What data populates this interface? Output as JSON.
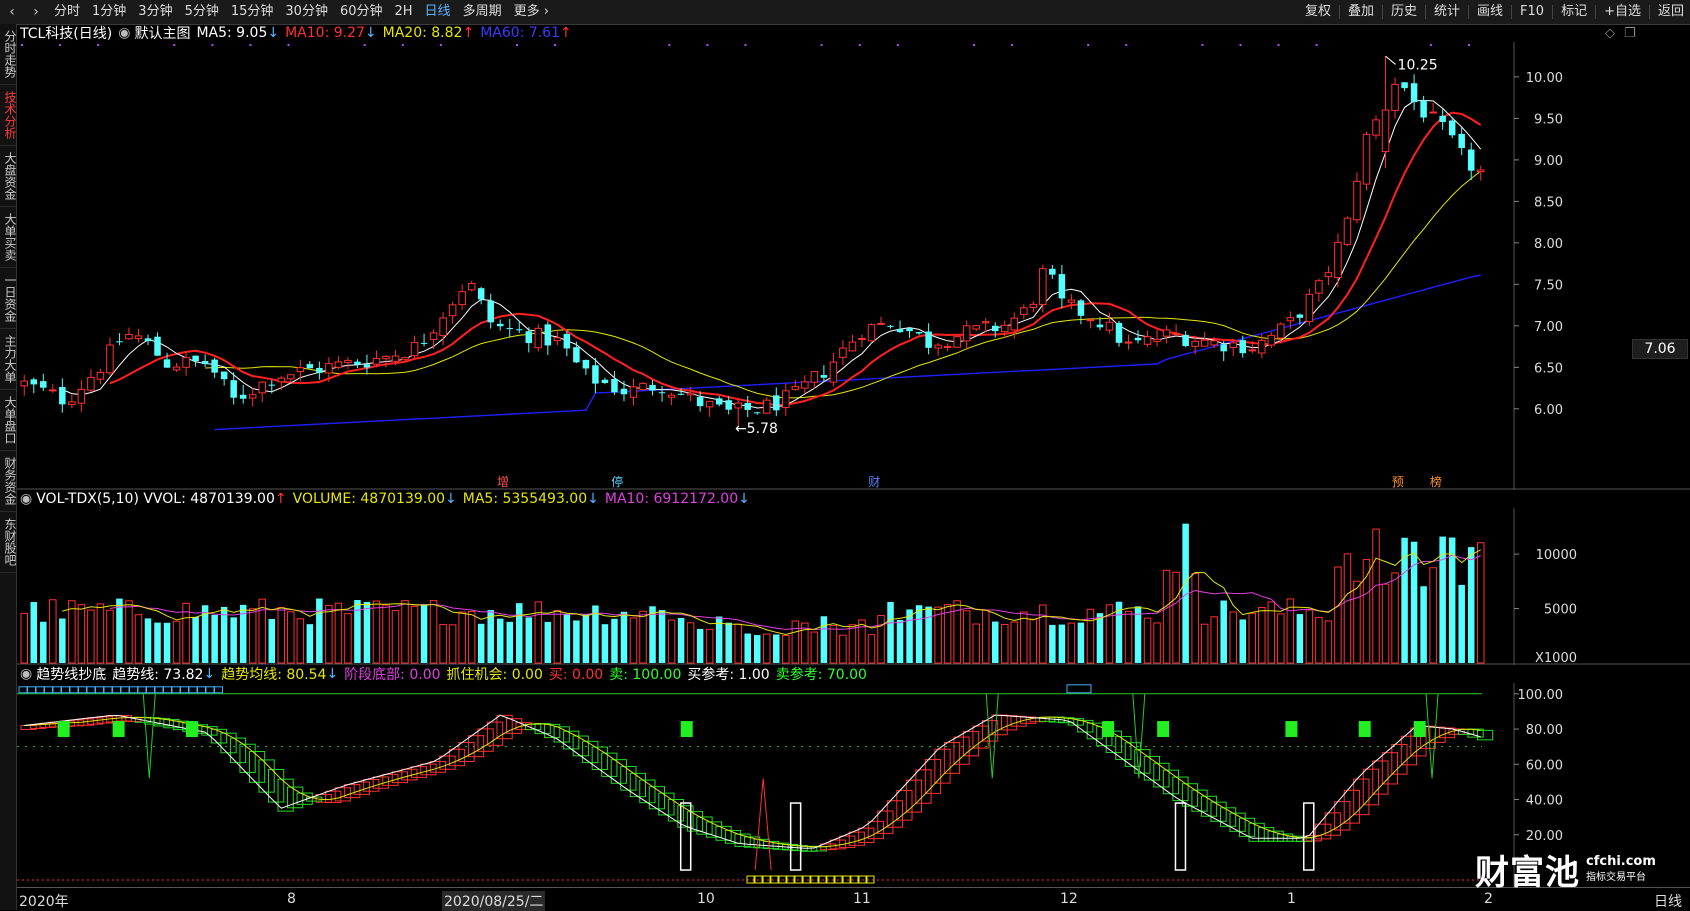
{
  "toolbar": {
    "periods": [
      "分时",
      "1分钟",
      "3分钟",
      "5分钟",
      "15分钟",
      "30分钟",
      "60分钟",
      "2H",
      "日线",
      "多周期",
      "更多"
    ],
    "active_period": "日线",
    "right_items": [
      "复权",
      "叠加",
      "历史",
      "统计",
      "画线",
      "F10",
      "标记",
      "+自选",
      "返回"
    ]
  },
  "sidebar": {
    "items": [
      "分时走势",
      "技术分析",
      "大盘资金",
      "大单买卖",
      "一日资金",
      "主力大单",
      "大单盘口",
      "财务资金",
      "东财股吧"
    ],
    "active": "技术分析"
  },
  "main_chart": {
    "stock_name": "TCL科技(日线)",
    "indicator_name": "默认主图",
    "ma5": {
      "label": "MA5: 9.05",
      "arrow": "↓",
      "color": "#ffffff"
    },
    "ma10": {
      "label": "MA10: 9.27",
      "arrow": "↓",
      "color": "#ff3030"
    },
    "ma20": {
      "label": "MA20: 8.82",
      "arrow": "↑",
      "color": "#ffff00"
    },
    "ma60": {
      "label": "MA60: 7.61",
      "arrow": "↑",
      "color": "#3030ff"
    },
    "y_ticks": [
      "10.00",
      "9.50",
      "9.00",
      "8.50",
      "8.00",
      "7.50",
      "7.00",
      "6.50",
      "6.00"
    ],
    "current_price": "7.06",
    "high_label": "10.25",
    "low_label": "5.78",
    "event_markers": [
      {
        "text": "增",
        "color": "#ff5050"
      },
      {
        "text": "停",
        "color": "#50d0ff"
      },
      {
        "text": "财",
        "color": "#5080ff"
      },
      {
        "text": "预",
        "color": "#ff9030"
      },
      {
        "text": "榜",
        "color": "#ff9030"
      }
    ]
  },
  "volume_chart": {
    "title": "VOL-TDX(5,10) VVOL: 4870139.00",
    "title_arrow": "↑",
    "volume": "VOLUME: 4870139.00",
    "volume_arrow": "↓",
    "ma5": "MA5: 5355493.00",
    "ma5_arrow": "↓",
    "ma10": "MA10: 6912172.00",
    "ma10_arrow": "↓",
    "y_ticks": [
      "10000",
      "5000"
    ],
    "unit": "X1000"
  },
  "indicator_chart": {
    "title": "趋势线抄底",
    "trend": "趋势线: 73.82",
    "trend_arrow": "↓",
    "trend_avg": "趋势均线: 80.54",
    "trend_avg_arrow": "↓",
    "stage_bottom": "阶段底部: 0.00",
    "catch_chance": "抓住机会: 0.00",
    "buy": "买: 0.00",
    "sell": "卖: 100.00",
    "buy_ref": "买参考: 1.00",
    "sell_ref": "卖参考: 70.00",
    "y_ticks": [
      "100.00",
      "80.00",
      "60.00",
      "40.00",
      "20.00"
    ]
  },
  "x_axis": {
    "labels": [
      "2020年",
      "8",
      "2020/08/25/二",
      "10",
      "11",
      "12",
      "1",
      "2"
    ],
    "right_label": "日线"
  },
  "watermark": {
    "brand": "财富池",
    "domain": "cfchi.com",
    "tagline": "指标交易平台"
  },
  "colors": {
    "up": "#ff3030",
    "down": "#54ffff",
    "ma5": "#ffffff",
    "ma10": "#ff2020",
    "ma20": "#e6e600",
    "ma60": "#2020ff",
    "volma10": "#e040e0"
  }
}
